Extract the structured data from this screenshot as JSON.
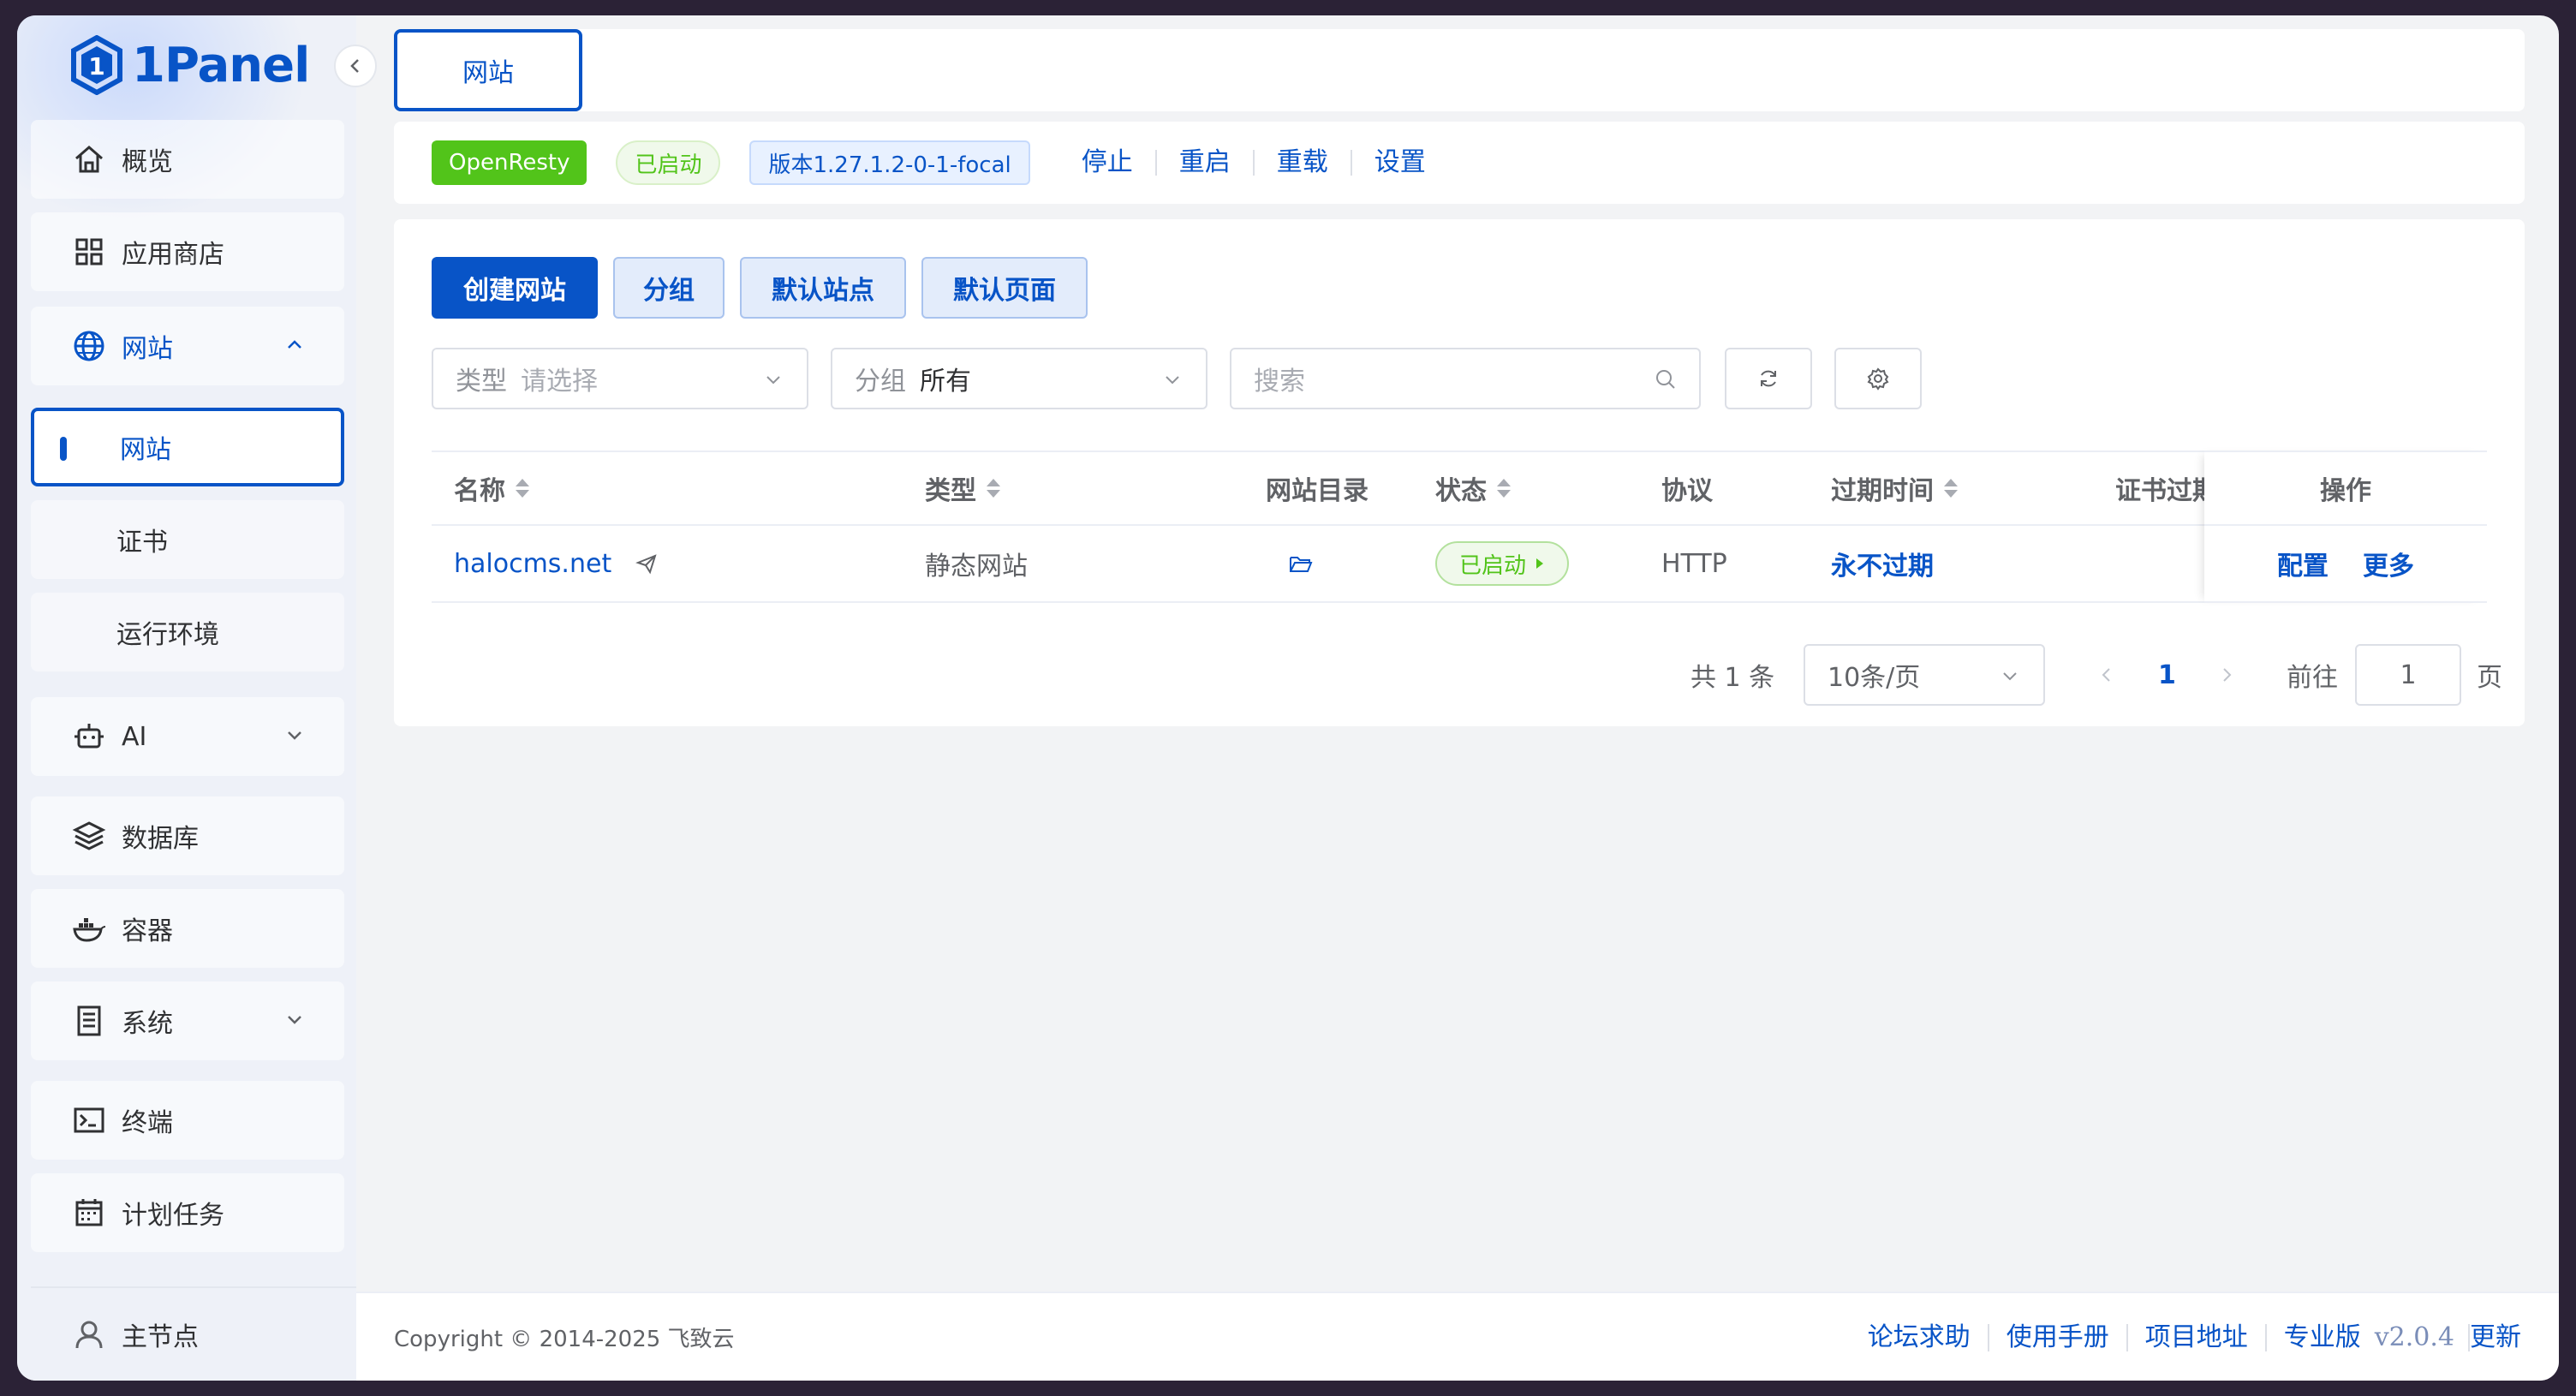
{
  "app": {
    "logo_text": "1Panel",
    "brand_color": "#0854c7"
  },
  "sidebar": {
    "items": [
      {
        "label": "概览",
        "icon": "home-icon"
      },
      {
        "label": "应用商店",
        "icon": "grid-icon"
      },
      {
        "label": "网站",
        "icon": "globe-icon",
        "expanded": true
      },
      {
        "label": "AI",
        "icon": "robot-icon",
        "expanded": false
      },
      {
        "label": "数据库",
        "icon": "layers-icon"
      },
      {
        "label": "容器",
        "icon": "docker-icon"
      },
      {
        "label": "系统",
        "icon": "server-icon",
        "expanded": false
      },
      {
        "label": "终端",
        "icon": "terminal-icon"
      },
      {
        "label": "计划任务",
        "icon": "calendar-icon"
      }
    ],
    "sub_items": [
      {
        "label": "网站",
        "active": true
      },
      {
        "label": "证书"
      },
      {
        "label": "运行环境"
      }
    ],
    "node_label": "主节点"
  },
  "tabs": {
    "active": "网站"
  },
  "appbar": {
    "app_name": "OpenResty",
    "status": "已启动",
    "version": "版本1.27.1.2-0-1-focal",
    "actions": [
      "停止",
      "重启",
      "重载",
      "设置"
    ]
  },
  "toolbar": {
    "create_label": "创建网站",
    "group_label": "分组",
    "default_site_label": "默认站点",
    "default_page_label": "默认页面"
  },
  "filters": {
    "type": {
      "prefix": "类型",
      "placeholder": "请选择"
    },
    "group": {
      "prefix": "分组",
      "value": "所有"
    },
    "search": {
      "placeholder": "搜索"
    }
  },
  "table": {
    "headers": {
      "name": "名称",
      "type": "类型",
      "dir": "网站目录",
      "status": "状态",
      "protocol": "协议",
      "expire": "过期时间",
      "cert": "证书过期",
      "ops": "操作"
    },
    "rows": [
      {
        "name": "halocms.net",
        "type": "静态网站",
        "status": "已启动",
        "protocol": "HTTP",
        "expire": "永不过期",
        "op_config": "配置",
        "op_more": "更多"
      }
    ]
  },
  "pagination": {
    "total": "共 1 条",
    "page_size": "10条/页",
    "current_page": "1",
    "goto_prefix": "前往",
    "goto_value": "1",
    "goto_suffix": "页"
  },
  "footer": {
    "copyright": "Copyright © 2014-2025 飞致云",
    "links": [
      "论坛求助",
      "使用手册",
      "项目地址",
      "专业版"
    ],
    "version": "v2.0.4",
    "update": "更新"
  }
}
